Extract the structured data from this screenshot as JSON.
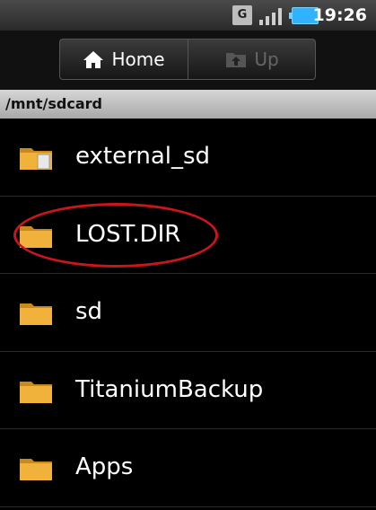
{
  "status": {
    "time": "19:26",
    "network_badge": "G",
    "icons": [
      "network-g-icon",
      "signal-icon",
      "battery-icon"
    ]
  },
  "toolbar": {
    "home_label": "Home",
    "up_label": "Up"
  },
  "path": {
    "current": "/mnt/sdcard"
  },
  "files": [
    {
      "name": "external_sd",
      "icon": "folder-with-file-icon"
    },
    {
      "name": "LOST.DIR",
      "icon": "folder-icon"
    },
    {
      "name": "sd",
      "icon": "folder-icon"
    },
    {
      "name": "TitaniumBackup",
      "icon": "folder-icon"
    },
    {
      "name": "Apps",
      "icon": "folder-icon"
    }
  ],
  "colors": {
    "highlight_circle": "#c9151b",
    "folder": "#f0b23a",
    "pathbar": "#c0c0c0"
  }
}
